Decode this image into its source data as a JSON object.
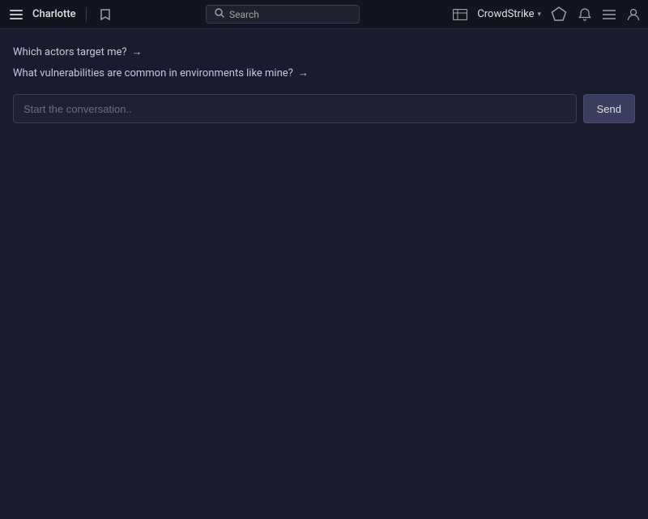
{
  "navbar": {
    "title": "Charlotte",
    "search_placeholder": "Search",
    "crowdstrike_label": "CrowdStrike",
    "hamburger_label": "menu",
    "bookmark_label": "bookmark",
    "chevron_label": "▾"
  },
  "suggestions": [
    {
      "text": "Which actors target me?",
      "arrow": "→"
    },
    {
      "text": "What vulnerabilities are common in environments like mine?",
      "arrow": "→"
    }
  ],
  "input": {
    "placeholder": "Start the conversation..",
    "send_label": "Send"
  }
}
